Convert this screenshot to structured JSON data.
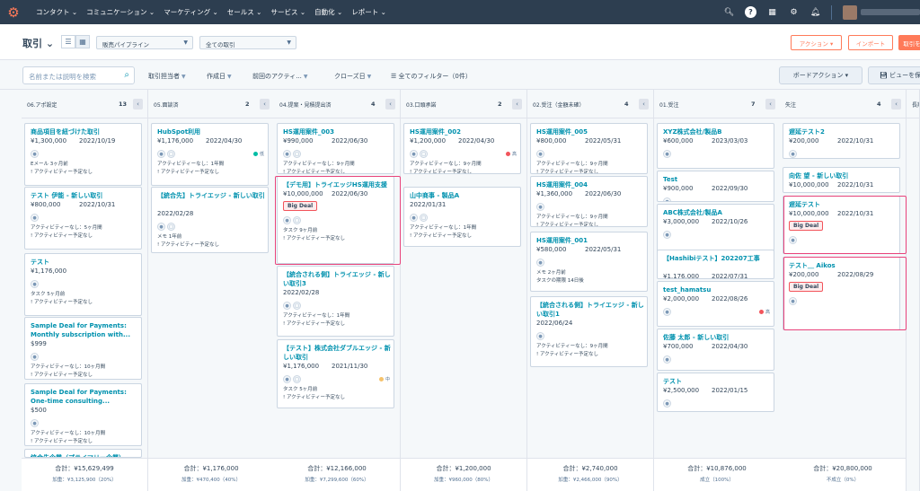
{
  "topnav": {
    "logo": "⚙",
    "items": [
      "コンタクト ⌄",
      "コミュニケーション ⌄",
      "マーケティング ⌄",
      "セールス ⌄",
      "サービス ⌄",
      "自動化 ⌄",
      "レポート ⌄"
    ]
  },
  "header": {
    "title": "取引 ⌄",
    "pipeline": "販売パイプライン",
    "owner": "全ての取引",
    "actions_btn": "アクション ▾",
    "import_btn": "インポート",
    "create_btn": "取引を"
  },
  "filters": {
    "search_placeholder": "名前または説明を検索",
    "items": [
      "取引担当者",
      "作成日",
      "前回のアクティ...",
      "クローズ日",
      "全てのフィルター（0件）"
    ],
    "board_actions": "ボードアクション ▾",
    "view_btn": "ビューを保"
  },
  "columns": [
    {
      "name": "06.アポ設定",
      "count": "13",
      "total": "合計：¥15,629,499",
      "weighted": "加重：¥3,125,900（20%）",
      "cards": [
        {
          "name": "商品項目を紐づけた取引",
          "amount": "¥1,300,000",
          "date": "2022/10/19",
          "acts": [
            "Eメール 3ヶ月前",
            "! アクティビティー予定なし"
          ]
        },
        {
          "name": "テスト 伊能 - 新しい取引",
          "amount": "¥800,000",
          "date": "2022/10/31",
          "acts": [
            "アクティビティーなし：5ヶ月間",
            "! アクティビティー予定なし"
          ]
        },
        {
          "name": "テスト",
          "amount": "¥1,176,000",
          "date": "",
          "acts": [
            "タスク 5ヶ月前",
            "! アクティビティー予定なし"
          ]
        },
        {
          "name": "Sample Deal for Payments: Monthly subscription with...",
          "amount": "$999",
          "date": "",
          "acts": [
            "アクティビティーなし：10ヶ月間",
            "! アクティビティー予定なし"
          ]
        },
        {
          "name": "Sample Deal for Payments: One-time consulting...",
          "amount": "$500",
          "date": "",
          "acts": [
            "アクティビティーなし：10ヶ月間",
            "! アクティビティー予定なし"
          ]
        },
        {
          "name": "統合先企業（プライマリー企業）",
          "amount": "",
          "date": "",
          "acts": []
        }
      ]
    },
    {
      "name": "05.面談済",
      "count": "2",
      "total": "合計：¥1,176,000",
      "weighted": "加重：¥470,400（40%）",
      "cards": [
        {
          "name": "HubSpot利用",
          "amount": "¥1,176,000",
          "date": "2022/04/30",
          "pri": "低",
          "acts": [
            "アクティビティーなし：1年間",
            "! アクティビティー予定なし"
          ]
        },
        {
          "name": "【統合先】トライエッジ - 新しい取引",
          "amount": "",
          "date": "2022/02/28",
          "acts": [
            "メモ 1年前",
            "! アクティビティー予定なし"
          ]
        }
      ]
    },
    {
      "name": "04.提案・見積提出済",
      "count": "4",
      "total": "合計：¥12,166,000",
      "weighted": "加重：¥7,299,600（60%）",
      "cards": [
        {
          "name": "HS運用案件_003",
          "amount": "¥990,000",
          "date": "2022/06/30",
          "acts": [
            "アクティビティーなし：9ヶ月間",
            "! アクティビティー予定なし"
          ]
        },
        {
          "name": "【デモ用】トライエッジHS運用支援",
          "amount": "¥10,000,000",
          "date": "2022/06/30",
          "tag": "Big Deal",
          "acts": [
            "タスク 9ヶ月前",
            "! アクティビティー予定なし"
          ]
        },
        {
          "name": "【統合される側】トライエッジ - 新しい取引3",
          "amount": "",
          "date": "2022/02/28",
          "acts": [
            "アクティビティーなし：1年間",
            "! アクティビティー予定なし"
          ]
        },
        {
          "name": "【テスト】株式会社ダブルエッジ - 新しい取引",
          "amount": "¥1,176,000",
          "date": "2021/11/30",
          "pri": "中",
          "acts": [
            "タスク 5ヶ月前",
            "! アクティビティー予定なし"
          ]
        }
      ]
    },
    {
      "name": "03.口頭承諾",
      "count": "2",
      "total": "合計：¥1,200,000",
      "weighted": "加重：¥960,000（80%）",
      "cards": [
        {
          "name": "HS運用案件_002",
          "amount": "¥1,200,000",
          "date": "2022/04/30",
          "pri": "高",
          "acts": [
            "アクティビティーなし：9ヶ月間",
            "! アクティビティー予定なし"
          ]
        },
        {
          "name": "山中商事 - 製品A",
          "amount": "",
          "date": "2022/01/31",
          "acts": [
            "アクティビティーなし：1年間",
            "! アクティビティー予定なし"
          ]
        }
      ]
    },
    {
      "name": "02.受注（金額未確）",
      "count": "4",
      "total": "合計：¥2,740,000",
      "weighted": "加重：¥2,466,000（90%）",
      "cards": [
        {
          "name": "HS運用案件_005",
          "amount": "¥800,000",
          "date": "2022/05/31",
          "acts": [
            "アクティビティーなし：9ヶ月間",
            "! アクティビティー予定なし"
          ]
        },
        {
          "name": "HS運用案件_004",
          "amount": "¥1,360,000",
          "date": "2022/06/30",
          "acts": [
            "アクティビティーなし：9ヶ月間",
            "! アクティビティー予定なし"
          ]
        },
        {
          "name": "HS運用案件_001",
          "amount": "¥580,000",
          "date": "2022/05/31",
          "acts": [
            "メモ 2ヶ月前",
            "タスクの期限 14日後"
          ]
        },
        {
          "name": "【統合される側】トライエッジ - 新しい取引1",
          "amount": "",
          "date": "2022/06/24",
          "acts": [
            "アクティビティーなし：9ヶ月間",
            "! アクティビティー予定なし"
          ]
        }
      ]
    },
    {
      "name": "01.受注",
      "count": "7",
      "total": "合計：¥10,876,000",
      "weighted": "成立（100%）",
      "cards": [
        {
          "name": "XYZ株式会社/製品B",
          "amount": "¥600,000",
          "date": "2023/03/03"
        },
        {
          "name": "Test",
          "amount": "¥900,000",
          "date": "2022/09/30"
        },
        {
          "name": "ABC株式会社/製品A",
          "amount": "¥3,000,000",
          "date": "2022/10/26"
        },
        {
          "name": "【Hashibiテスト】202207工事",
          "amount": "¥1,176,000",
          "date": "2022/07/31"
        },
        {
          "name": "test_hamatsu",
          "amount": "¥2,000,000",
          "date": "2022/08/26",
          "pri": "高"
        },
        {
          "name": "佐藤 太郎 - 新しい取引",
          "amount": "¥700,000",
          "date": "2022/04/30"
        },
        {
          "name": "テスト",
          "amount": "¥2,500,000",
          "date": "2022/01/15"
        }
      ]
    },
    {
      "name": "失注",
      "count": "4",
      "total": "合計：¥20,800,000",
      "weighted": "不成立（0%）",
      "cards": [
        {
          "name": "遅延テスト2",
          "amount": "¥200,000",
          "date": "2022/10/31"
        },
        {
          "name": "向佐 望 - 新しい取引",
          "amount": "¥10,000,000",
          "date": "2022/10/31"
        },
        {
          "name": "遅延テスト",
          "amount": "¥10,000,000",
          "date": "2022/10/31",
          "tag": "Big Deal"
        },
        {
          "name": "テスト＿ Aikos",
          "amount": "¥200,000",
          "date": "2022/08/29",
          "tag": "Big Deal"
        }
      ]
    },
    {
      "name": "長期",
      "count": "",
      "total": "",
      "weighted": "",
      "cards": []
    }
  ]
}
